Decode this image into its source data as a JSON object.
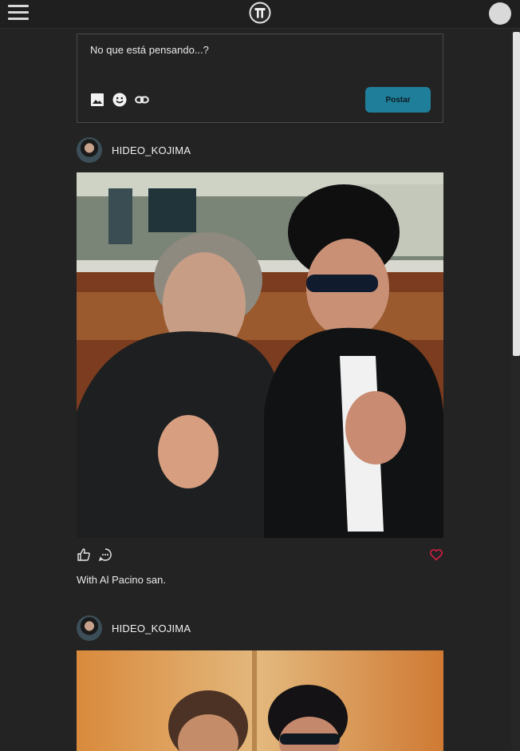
{
  "composer": {
    "placeholder": "No que está pensando...?",
    "post_label": "Postar",
    "tools": [
      "image-icon",
      "emoji-icon",
      "link-icon"
    ]
  },
  "colors": {
    "background": "#232323",
    "accent": "#1f7f9b",
    "like": "#e11d48"
  },
  "posts": [
    {
      "username": "HIDEO_KOJIMA",
      "caption": "With Al Pacino san.",
      "liked": false
    },
    {
      "username": "HIDEO_KOJIMA",
      "caption": "",
      "liked": false
    }
  ]
}
